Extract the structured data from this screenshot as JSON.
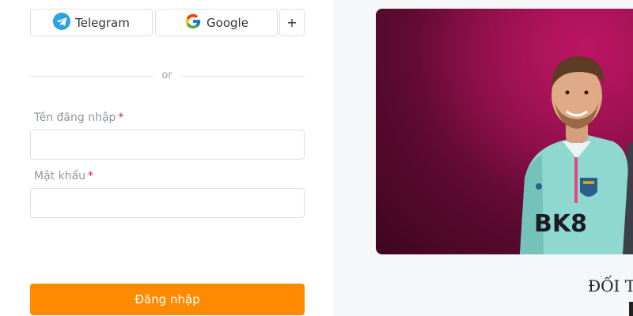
{
  "social": {
    "telegram_label": "Telegram",
    "google_label": "Google",
    "more_label": "+"
  },
  "divider_text": "or",
  "form": {
    "username_label": "Tên đăng nhập",
    "username_value": "",
    "password_label": "Mật khẩu",
    "password_value": "",
    "required_mark": "*",
    "submit_label": "Đăng nhập"
  },
  "banner": {
    "sponsor_text": "BK8"
  },
  "promo": {
    "title": "ĐỐI T"
  },
  "colors": {
    "accent": "#ff8a00",
    "required": "#e02424",
    "banner": "#8d0f48",
    "telegram": "#2aa3df"
  },
  "icons": [
    "telegram-icon",
    "google-icon"
  ]
}
